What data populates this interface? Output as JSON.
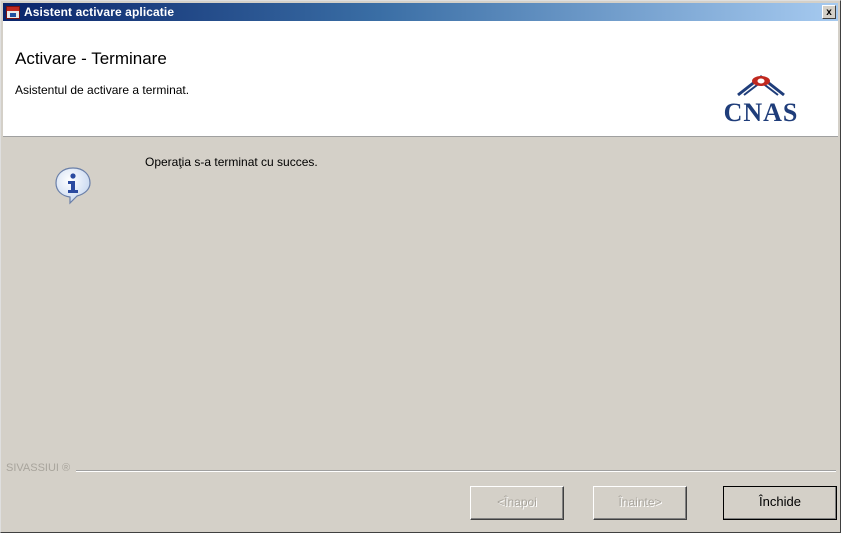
{
  "window": {
    "title": "Asistent activare aplicatie",
    "close_glyph": "x"
  },
  "header": {
    "title": "Activare - Terminare",
    "subtitle": "Asistentul de activare a terminat.",
    "logo_text": "CNAS"
  },
  "main": {
    "message": "Operaţia s-a terminat cu succes.",
    "icon": "info-icon"
  },
  "footer": {
    "brand": "SIVASSIUI ®"
  },
  "buttons": {
    "back_label": "<Înapoi",
    "next_label": "Înainte>",
    "close_label": "Închide"
  },
  "colors": {
    "titlebar_start": "#0a246a",
    "titlebar_end": "#a6caf0",
    "dialog_face": "#d4d0c8",
    "logo_blue": "#1f3d7a",
    "logo_red": "#c0281f"
  }
}
